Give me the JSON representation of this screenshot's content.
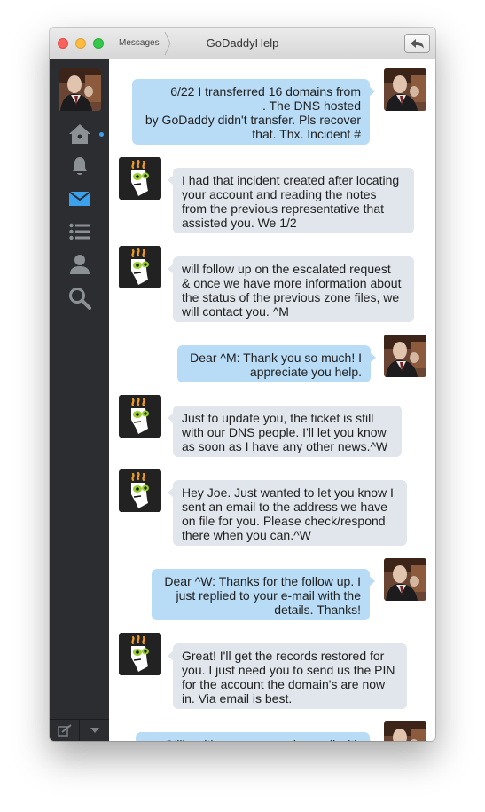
{
  "window": {
    "title": "GoDaddyHelp",
    "back_label": "Messages"
  },
  "sidebar": {
    "items": [
      {
        "name": "home",
        "icon": "home-icon",
        "unread": true
      },
      {
        "name": "notifications",
        "icon": "bell-icon"
      },
      {
        "name": "messages",
        "icon": "mail-icon",
        "active": true
      },
      {
        "name": "lists",
        "icon": "list-icon"
      },
      {
        "name": "profile",
        "icon": "person-icon"
      },
      {
        "name": "search",
        "icon": "search-icon"
      }
    ],
    "accent_color": "#3ba1ec",
    "bottom": [
      "compose-icon",
      "chevron-down-icon"
    ]
  },
  "messages": [
    {
      "from": "me",
      "text": "6/22 I transferred 16 domains from\n. The DNS hosted\nby GoDaddy didn't transfer. Pls recover\nthat. Thx. Incident #"
    },
    {
      "from": "godaddy",
      "text": "I had that incident created after locating\nyour account and reading the notes\nfrom the previous representative that\nassisted you.  We 1/2"
    },
    {
      "from": "godaddy",
      "text": "will follow up on the escalated request\n& once we have more information about\nthe status of the previous zone files, we\nwill contact you. ^M"
    },
    {
      "from": "me",
      "text": "Dear ^M: Thank you so much! I\nappreciate you help."
    },
    {
      "from": "godaddy",
      "text": "Just to update you, the ticket is still\nwith our DNS people. I'll let you know\nas soon as I have any other news.^W"
    },
    {
      "from": "godaddy",
      "text": "Hey Joe. Just wanted to let you know I\nsent an email to the address we have\non file for you. Please check/respond\nthere when you can.^W"
    },
    {
      "from": "me",
      "text": "Dear ^W: Thanks for the follow up. I\njust replied to your e-mail with the\ndetails. Thanks!"
    },
    {
      "from": "godaddy",
      "text": "Great! I'll get the records restored for\nyou. I just need you to send us the PIN\nfor the account the domain's are now\nin. Via email is best."
    },
    {
      "from": "me",
      "text": "Still waiting on your reply email with"
    }
  ],
  "colors": {
    "outgoing_bubble": "#b9dcf6",
    "incoming_bubble": "#e1e6ec",
    "sidebar_bg": "#2b2d30"
  }
}
